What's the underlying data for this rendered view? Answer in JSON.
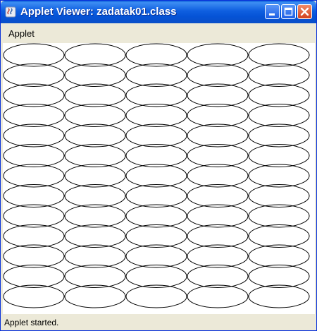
{
  "window": {
    "title": "Applet Viewer: zadatak01.class",
    "controls": [
      "minimize-icon",
      "maximize-icon",
      "close-icon"
    ]
  },
  "menubar": {
    "items": [
      {
        "label": "Applet"
      }
    ]
  },
  "canvas": {
    "pattern": "ellipse-grid",
    "rows": 13,
    "columns": 5,
    "stroke_color": "#000000",
    "background": "#ffffff"
  },
  "status": {
    "text": "Applet started."
  },
  "colors": {
    "titlebar": "#0a5fd8",
    "close_button": "#d3411d",
    "chrome": "#ece9d8"
  }
}
